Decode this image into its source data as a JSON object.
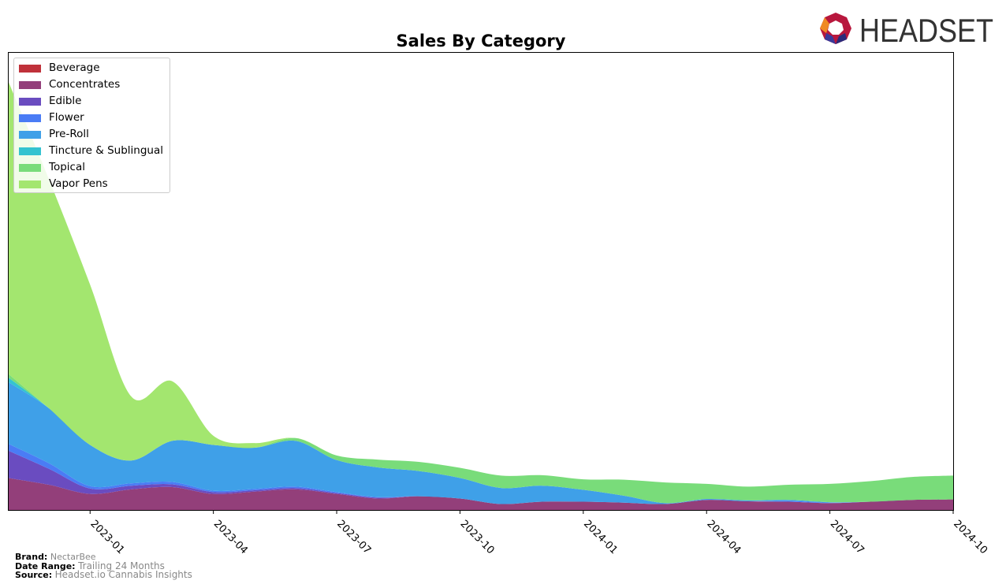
{
  "header": {
    "logo_text": "HEADSET"
  },
  "footer": {
    "brand_label": "Brand:",
    "brand_value": "NectarBee",
    "range_label": "Date Range:",
    "range_value": "Trailing 24 Months",
    "source_label": "Source:",
    "source_value": "Headset.io Cannabis Insights"
  },
  "chart_data": {
    "type": "area",
    "stacked": true,
    "title": "Sales By Category",
    "xlabel": "",
    "ylabel": "",
    "x": [
      "2022-11",
      "2022-12",
      "2023-01",
      "2023-02",
      "2023-03",
      "2023-04",
      "2023-05",
      "2023-06",
      "2023-07",
      "2023-08",
      "2023-09",
      "2023-10",
      "2023-11",
      "2023-12",
      "2024-01",
      "2024-02",
      "2024-03",
      "2024-04",
      "2024-05",
      "2024-06",
      "2024-07",
      "2024-08",
      "2024-09",
      "2024-10"
    ],
    "xticks": [
      "2023-01",
      "2023-04",
      "2023-07",
      "2023-10",
      "2024-01",
      "2024-04",
      "2024-07",
      "2024-10"
    ],
    "ylim": [
      0,
      100
    ],
    "legend_position": "top-left",
    "series": [
      {
        "name": "Beverage",
        "color": "#c0313a",
        "values": [
          0,
          0,
          0,
          0,
          0,
          0,
          0,
          0,
          0,
          0,
          0,
          0,
          0,
          0,
          0,
          0,
          0,
          0,
          0,
          0,
          0,
          0,
          0,
          0
        ]
      },
      {
        "name": "Concentrates",
        "color": "#933f7a",
        "values": [
          7,
          5.5,
          3.5,
          4.5,
          5,
          3.5,
          4,
          4.5,
          3.5,
          2.5,
          3,
          2.5,
          1.3,
          1.8,
          1.8,
          1.6,
          1.3,
          2.2,
          1.9,
          1.8,
          1.5,
          1.8,
          2.2,
          2.3
        ]
      },
      {
        "name": "Edible",
        "color": "#6a4cc0",
        "values": [
          6,
          3.5,
          1.2,
          0.8,
          0.6,
          0.4,
          0.3,
          0.3,
          0.2,
          0.2,
          0,
          0,
          0,
          0,
          0,
          0,
          0,
          0,
          0,
          0,
          0,
          0,
          0,
          0
        ]
      },
      {
        "name": "Flower",
        "color": "#4a7cf5",
        "values": [
          1.5,
          1.2,
          0.5,
          0.5,
          0.5,
          0.3,
          0.3,
          0.3,
          0.2,
          0.1,
          0,
          0,
          0,
          0,
          0,
          0,
          0,
          0,
          0,
          0.2,
          0.1,
          0,
          0,
          0
        ]
      },
      {
        "name": "Pre-Roll",
        "color": "#3fa0e8",
        "values": [
          13.5,
          12,
          9,
          5,
          9,
          10,
          9,
          10,
          7,
          6.5,
          5.5,
          4.5,
          3.5,
          3.5,
          2.6,
          1.5,
          0.2,
          0.2,
          0.2,
          0.2,
          0.1,
          0,
          0,
          0
        ]
      },
      {
        "name": "Tincture & Sublingual",
        "color": "#34c3d0",
        "values": [
          1,
          0,
          0,
          0,
          0,
          0,
          0,
          0,
          0,
          0,
          0,
          0,
          0,
          0,
          0,
          0,
          0,
          0,
          0,
          0,
          0,
          0,
          0,
          0
        ]
      },
      {
        "name": "Topical",
        "color": "#79dc7a",
        "values": [
          0.8,
          0,
          0,
          0,
          0,
          0,
          0,
          0.6,
          1,
          1.7,
          2,
          2.2,
          2.7,
          2.3,
          2.3,
          3.5,
          4.5,
          3.3,
          3,
          3.3,
          4,
          4.5,
          5,
          5.2
        ]
      },
      {
        "name": "Vapor Pens",
        "color": "#a3e66f",
        "values": [
          64,
          50,
          35,
          14,
          13,
          2,
          1,
          0,
          0,
          0,
          0,
          0,
          0,
          0,
          0,
          0,
          0,
          0,
          0,
          0,
          0,
          0,
          0,
          0
        ]
      }
    ]
  }
}
